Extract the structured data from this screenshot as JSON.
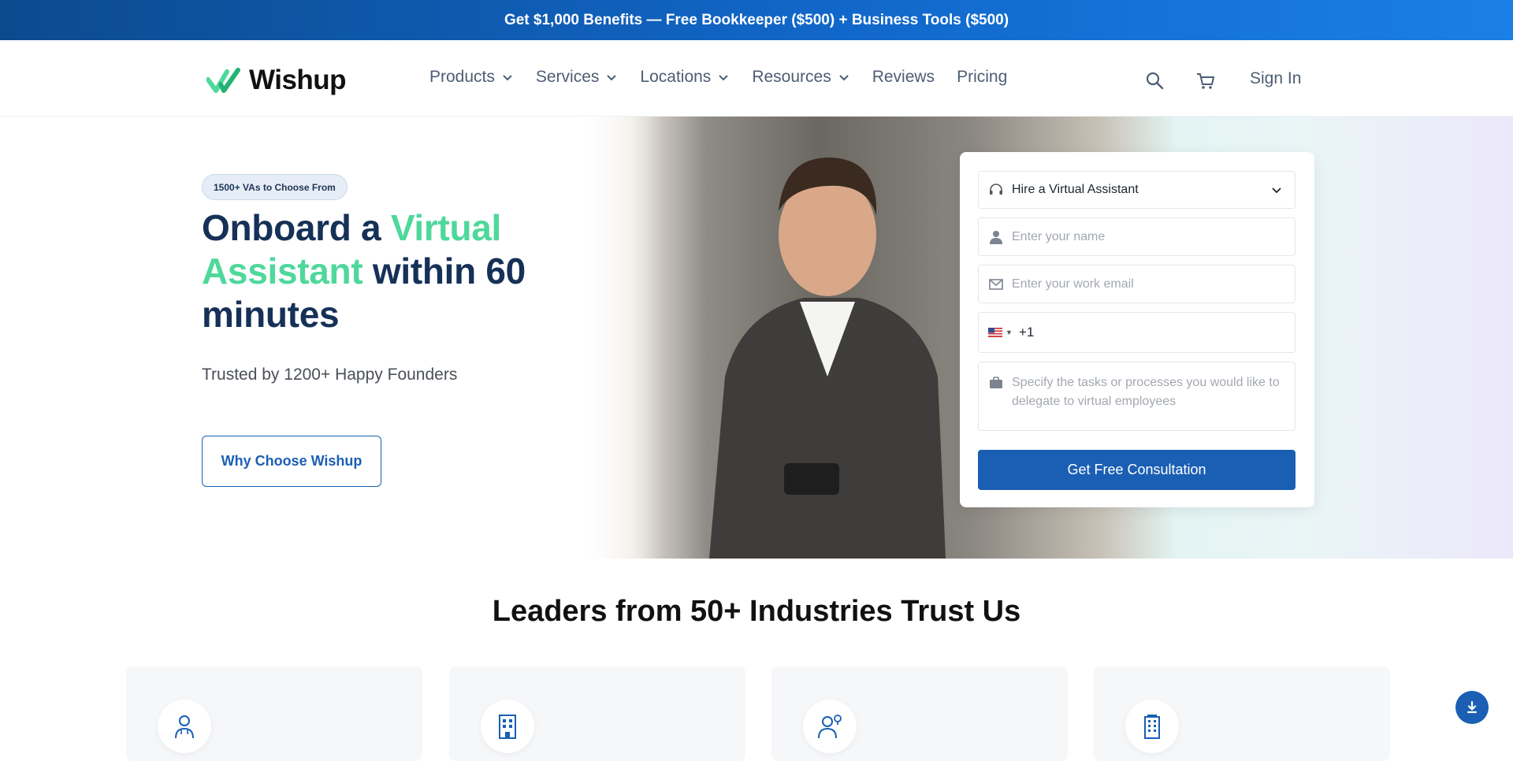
{
  "promo": {
    "text": "Get $1,000 Benefits — Free Bookkeeper ($500) + Business Tools ($500)"
  },
  "brand": {
    "name": "Wishup",
    "accent": "#4fd89b",
    "primary": "#1a5fb4",
    "navy": "#163157"
  },
  "nav": {
    "items": [
      {
        "label": "Products",
        "dropdown": true
      },
      {
        "label": "Services",
        "dropdown": true
      },
      {
        "label": "Locations",
        "dropdown": true
      },
      {
        "label": "Resources",
        "dropdown": true
      },
      {
        "label": "Reviews",
        "dropdown": false
      },
      {
        "label": "Pricing",
        "dropdown": false
      }
    ],
    "icons": [
      "search-icon",
      "cart-icon"
    ],
    "signin": "Sign In"
  },
  "hero": {
    "badge": "1500+ VAs to Choose From",
    "title_part1": "Onboard a ",
    "title_accent": "Virtual Assistant",
    "title_part2": " within 60 minutes",
    "subtitle": "Trusted by 1200+ Happy Founders",
    "cta": "Why Choose Wishup"
  },
  "form": {
    "select_value": "Hire a Virtual Assistant",
    "name_placeholder": "Enter your name",
    "email_placeholder": "Enter your work email",
    "phone_code": "+1",
    "tasks_placeholder": "Specify the tasks or processes you would like to delegate to virtual employees",
    "submit": "Get Free Consultation"
  },
  "industries": {
    "title": "Leaders from 50+ Industries Trust Us",
    "icons": [
      "doctor-icon",
      "building-icon",
      "professional-icon",
      "office-tower-icon"
    ]
  }
}
